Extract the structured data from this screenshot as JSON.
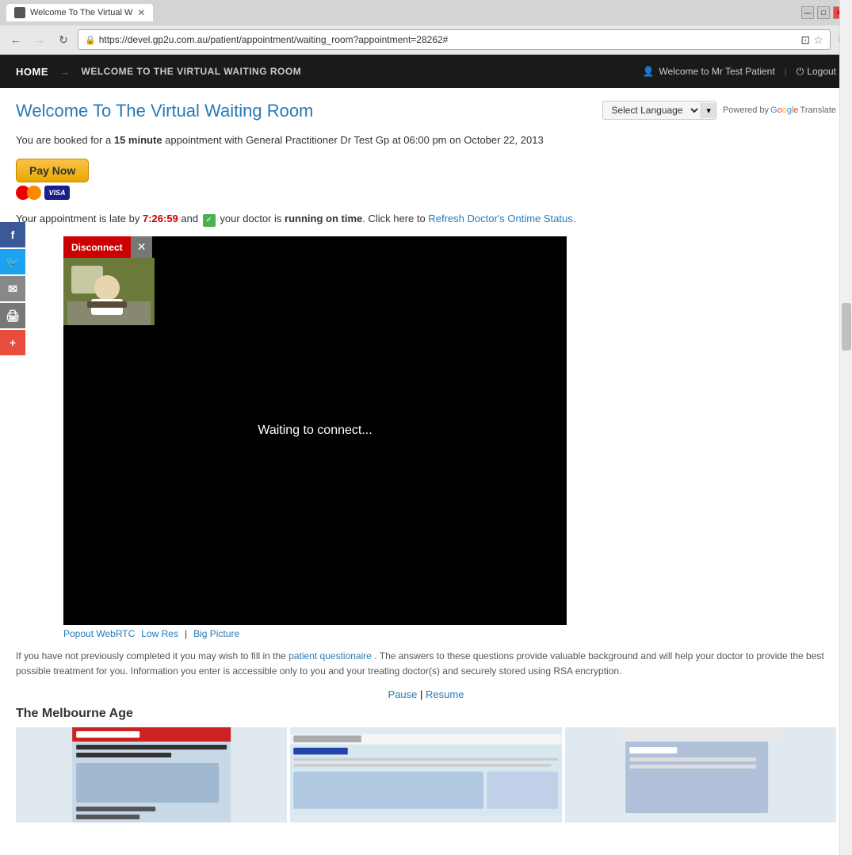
{
  "browser": {
    "tab_title": "Welcome To The Virtual W",
    "url": "https://devel.gp2u.com.au/patient/appointment/waiting_room?appointment=28262#",
    "window_controls": [
      "minimize",
      "maximize",
      "close"
    ]
  },
  "navbar": {
    "home_label": "HOME",
    "arrow": "→",
    "breadcrumb": "WELCOME TO THE VIRTUAL WAITING ROOM",
    "user_label": "Welcome to Mr Test Patient",
    "logout_label": "Logout"
  },
  "page": {
    "title": "Welcome To The Virtual Waiting Room",
    "language_selector_label": "Select Language",
    "powered_by_prefix": "Powered by",
    "powered_by_brand": "Google",
    "powered_by_suffix": "Translate",
    "appointment_text": "You are booked for a",
    "appointment_duration": "15 minute",
    "appointment_mid": "appointment with General Practitioner",
    "appointment_doctor": "Dr Test Gp",
    "appointment_time_prefix": "at",
    "appointment_time": "06:00 pm",
    "appointment_date_prefix": "on",
    "appointment_date": "October 22, 2013",
    "pay_now_label": "Pay Now",
    "visa_label": "VISA",
    "late_prefix": "Your appointment is late by",
    "late_time": "7:26:59",
    "late_mid": "and",
    "on_time_text": "your doctor is",
    "running_on_time": "running on time",
    "click_here": "Click here to",
    "refresh_link": "Refresh Doctor's Ontime Status.",
    "waiting_text": "Waiting to connect...",
    "disconnect_label": "Disconnect",
    "popout_label": "Popout WebRTC",
    "low_res_label": "Low Res",
    "big_picture_label": "Big Picture",
    "info_text": "If you have not previously completed it you may wish to fill in the",
    "questionaire_link": "patient questionaire",
    "info_text2": ". The answers to these questions provide valuable background and will help your doctor to provide the best possible treatment for you. Information you enter is accessible only to you and your treating doctor(s) and securely stored using RSA encryption.",
    "pause_label": "Pause",
    "resume_label": "Resume",
    "newspaper_title": "The Melbourne Age"
  },
  "social": {
    "facebook_label": "f",
    "twitter_label": "t",
    "email_label": "✉",
    "print_label": "🖨",
    "plus_label": "+"
  }
}
